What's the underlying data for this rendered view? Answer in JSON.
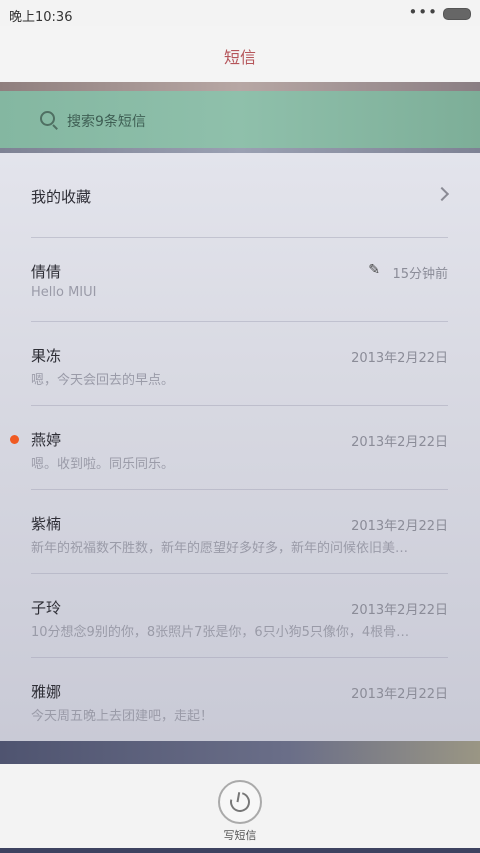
{
  "status_bar": {
    "time": "晚上10:36",
    "dots": "•••"
  },
  "header": {
    "title": "短信"
  },
  "search": {
    "placeholder": "搜索9条短信"
  },
  "favorites": {
    "label": "我的收藏"
  },
  "conversations": [
    {
      "name": "倩倩",
      "time": "15分钟前",
      "preview": "Hello MIUI",
      "draft": true,
      "unread": false
    },
    {
      "name": "果冻",
      "time": "2013年2月22日",
      "preview": "嗯，今天会回去的早点。",
      "unread": false
    },
    {
      "name": "燕婷",
      "time": "2013年2月22日",
      "preview": "嗯。收到啦。同乐同乐。",
      "unread": true
    },
    {
      "name": "紫楠",
      "time": "2013年2月22日",
      "preview": "新年的祝福数不胜数，新年的愿望好多好多，新年的问候依旧美…",
      "unread": false
    },
    {
      "name": "子玲",
      "time": "2013年2月22日",
      "preview": "10分想念9别的你，8张照片7张是你，6只小狗5只像你，4根骨…",
      "unread": false
    },
    {
      "name": "雅娜",
      "time": "2013年2月22日",
      "preview": "今天周五晚上去团建吧，走起！",
      "unread": false
    }
  ],
  "compose": {
    "label": "写短信"
  },
  "colors": {
    "accent": "#b5555a",
    "unread_dot": "#f05a22",
    "search_bar": "#8fc0ab"
  }
}
